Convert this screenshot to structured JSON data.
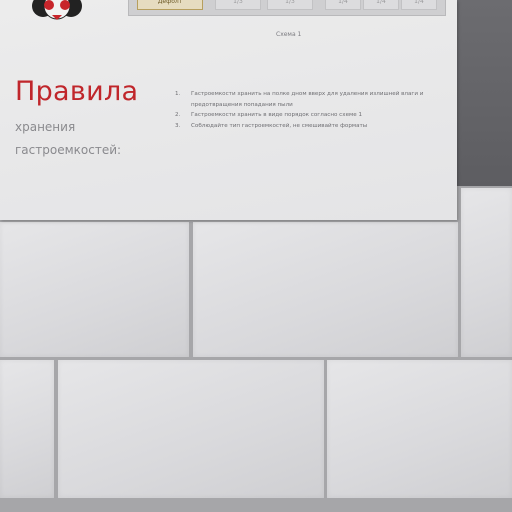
{
  "table": {
    "cells": [
      "Дефолт",
      "1/3",
      "1/3",
      "1/4",
      "1/4",
      "1/4"
    ],
    "caption": "Схема 1"
  },
  "heading": {
    "title": "Правила",
    "line1": "хранения",
    "line2": "гастроемкостей:"
  },
  "rules": [
    {
      "num": "1.",
      "text": "Гастроемкости хранить на полке дном вверх для удаления излишней влаги и предотвращения попадания пыли"
    },
    {
      "num": "2.",
      "text": "Гастроемкости хранить в виде порядок согласно схеме 1"
    },
    {
      "num": "3.",
      "text": "Соблюдайте тип гастроемкостей, не смешивайте форматы"
    }
  ],
  "colors": {
    "title_red": "#c0262b",
    "logo_red": "#c8252b",
    "logo_dark": "#222222"
  }
}
